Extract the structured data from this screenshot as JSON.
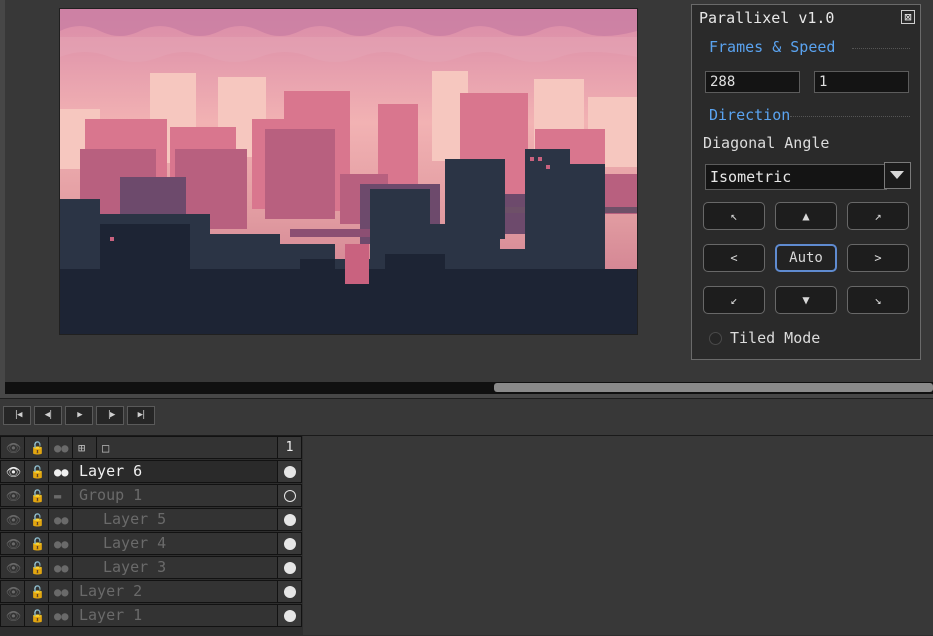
{
  "plugin": {
    "title": "Parallixel v1.0",
    "close_glyph": "⊠",
    "frames_speed_label": "Frames & Speed",
    "frames_value": "288",
    "speed_value": "1",
    "direction_label": "Direction",
    "diagonal_angle_label": "Diagonal Angle",
    "angle_selected": "Isometric",
    "dir": {
      "up_left": "↖",
      "up": "▲",
      "up_right": "↗",
      "left": "<",
      "auto": "Auto",
      "right": ">",
      "down_left": "↙",
      "down": "▼",
      "down_right": "↘"
    },
    "tiled_mode_label": "Tiled Mode",
    "accent_color": "#5aa3f0"
  },
  "timeline": {
    "controls": [
      "|◀",
      "◀|",
      "▶",
      "|▶",
      "▶|"
    ],
    "frame_number": "1",
    "layers": [
      {
        "name": "Layer 6",
        "selected": true
      },
      {
        "name": "Group 1",
        "group": true
      },
      {
        "name": "Layer 5",
        "indent": true
      },
      {
        "name": "Layer 4",
        "indent": true
      },
      {
        "name": "Layer 3",
        "indent": true
      },
      {
        "name": "Layer 2"
      },
      {
        "name": "Layer 1"
      }
    ]
  }
}
